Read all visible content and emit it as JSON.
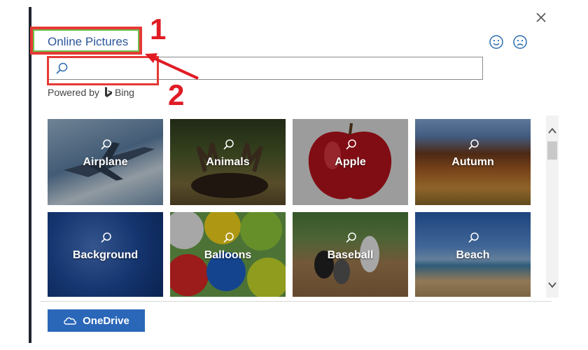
{
  "dialog": {
    "title": "Online Pictures",
    "close_icon": "close-icon",
    "feedback": {
      "smile_icon": "smiley-icon",
      "frown_icon": "frown-icon"
    }
  },
  "search": {
    "value": "",
    "placeholder": "",
    "icon": "search-icon"
  },
  "powered_by": {
    "text": "Powered by",
    "brand": "Bing"
  },
  "annotations": {
    "label_1": "1",
    "label_2": "2",
    "color": "#e01b24"
  },
  "categories": [
    {
      "label": "Airplane"
    },
    {
      "label": "Animals"
    },
    {
      "label": "Apple"
    },
    {
      "label": "Autumn"
    },
    {
      "label": "Background"
    },
    {
      "label": "Balloons"
    },
    {
      "label": "Baseball"
    },
    {
      "label": "Beach"
    }
  ],
  "footer": {
    "onedrive_label": "OneDrive"
  },
  "colors": {
    "accent": "#2b579a",
    "button": "#2b67b9"
  }
}
